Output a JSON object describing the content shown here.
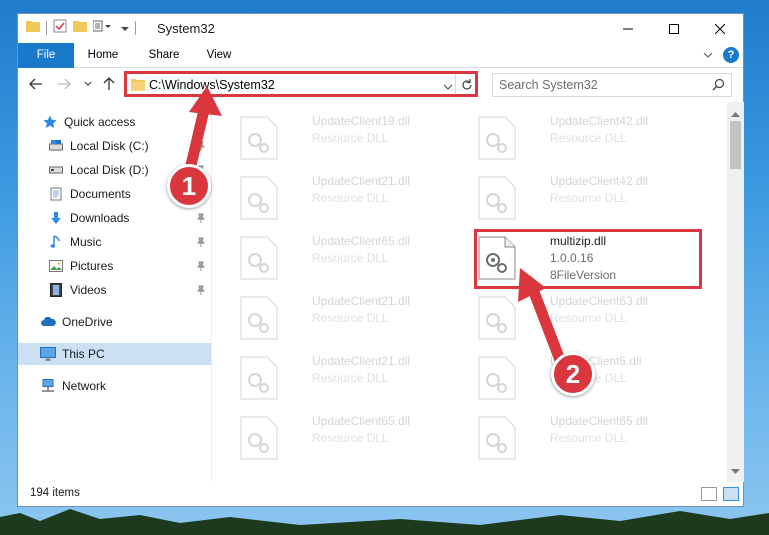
{
  "window": {
    "title": "System32"
  },
  "ribbon": {
    "tabs": [
      "File",
      "Home",
      "Share",
      "View"
    ],
    "help": "?"
  },
  "address": {
    "path": "C:\\Windows\\System32"
  },
  "search": {
    "placeholder": "Search System32"
  },
  "sidebar": {
    "items": [
      {
        "label": "Quick access",
        "icon": "star-icon"
      },
      {
        "label": "Local Disk (C:)",
        "icon": "drive-icon"
      },
      {
        "label": "Local Disk (D:)",
        "icon": "drive-icon"
      },
      {
        "label": "Documents",
        "icon": "documents-icon"
      },
      {
        "label": "Downloads",
        "icon": "download-icon"
      },
      {
        "label": "Music",
        "icon": "music-icon"
      },
      {
        "label": "Pictures",
        "icon": "pictures-icon"
      },
      {
        "label": "Videos",
        "icon": "videos-icon"
      },
      {
        "label": "OneDrive",
        "icon": "cloud-icon"
      },
      {
        "label": "This PC",
        "icon": "computer-icon"
      },
      {
        "label": "Network",
        "icon": "network-icon"
      }
    ]
  },
  "files": {
    "left": [
      {
        "name": "UpdateClient19.dll",
        "sub": "Resource DLL"
      },
      {
        "name": "UpdateClient21.dll",
        "sub": "Resource DLL"
      },
      {
        "name": "UpdateClient65.dll",
        "sub": "Resource DLL"
      },
      {
        "name": "UpdateClient21.dll",
        "sub": "Resource DLL"
      },
      {
        "name": "UpdateClient21.dll",
        "sub": "Resource DLL"
      },
      {
        "name": "UpdateClient65.dll",
        "sub": "Resource DLL"
      }
    ],
    "right": [
      {
        "name": "UpdateClient42.dll",
        "sub": "Resource DLL"
      },
      {
        "name": "UpdateClient42.dll",
        "sub": "Resource DLL"
      },
      {
        "name": "multizip.dll",
        "sub": "1.0.0.16",
        "sub2": "8FileVersion"
      },
      {
        "name": "UpdateClient63.dll",
        "sub": "Resource DLL"
      },
      {
        "name": "UpdateClient5.dll",
        "sub": "Resource DLL"
      },
      {
        "name": "UpdateClient65.dll",
        "sub": "Resource DLL"
      }
    ]
  },
  "status": {
    "count": "194 items"
  },
  "annotations": {
    "step1": "1",
    "step2": "2",
    "color": "#d9363e"
  }
}
